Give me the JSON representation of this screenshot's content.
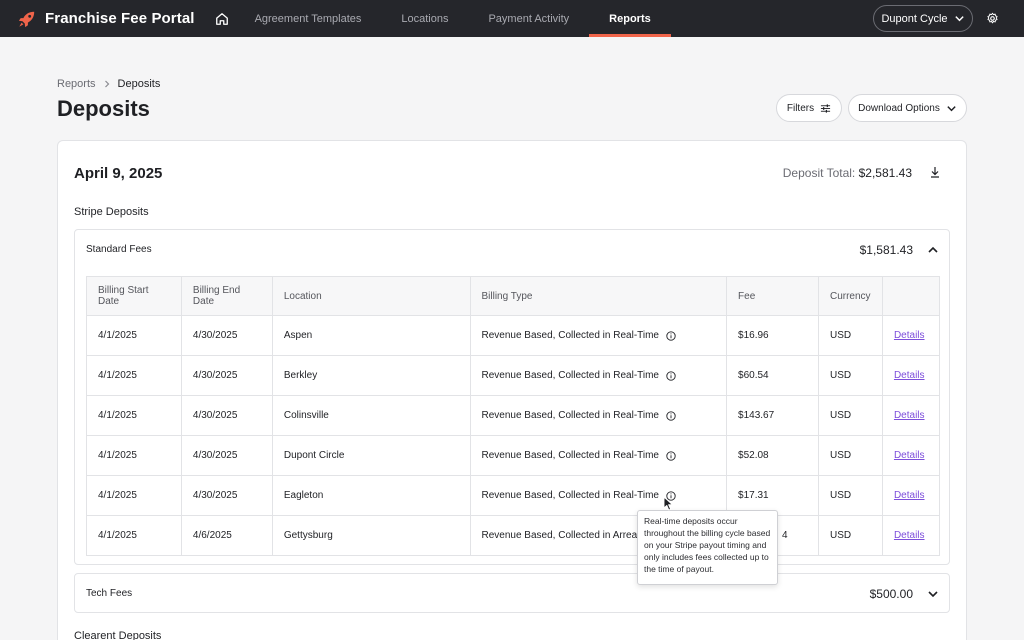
{
  "app": {
    "title": "Franchise Fee Portal"
  },
  "nav": {
    "items": [
      {
        "label": "Agreement Templates",
        "active": false
      },
      {
        "label": "Locations",
        "active": false
      },
      {
        "label": "Payment Activity",
        "active": false
      },
      {
        "label": "Reports",
        "active": true
      }
    ]
  },
  "account": {
    "name": "Dupont Cycle"
  },
  "breadcrumb": {
    "root": "Reports",
    "current": "Deposits"
  },
  "page": {
    "title": "Deposits"
  },
  "actions": {
    "filters_label": "Filters",
    "download_label": "Download Options"
  },
  "deposit": {
    "date": "April 9, 2025",
    "total_label": "Deposit Total:",
    "total_value": "$2,581.43",
    "stripe_title": "Stripe Deposits",
    "clearent_title": "Clearent Deposits"
  },
  "standard_fees": {
    "label": "Standard Fees",
    "amount": "$1,581.43",
    "columns": [
      "Billing Start Date",
      "Billing End Date",
      "Location",
      "Billing Type",
      "Fee",
      "Currency",
      ""
    ],
    "rows": [
      {
        "start": "4/1/2025",
        "end": "4/30/2025",
        "location": "Aspen",
        "type": "Revenue Based, Collected in Real-Time",
        "fee": "$16.96",
        "currency": "USD",
        "link": "Details"
      },
      {
        "start": "4/1/2025",
        "end": "4/30/2025",
        "location": "Berkley",
        "type": "Revenue Based, Collected in Real-Time",
        "fee": "$60.54",
        "currency": "USD",
        "link": "Details"
      },
      {
        "start": "4/1/2025",
        "end": "4/30/2025",
        "location": "Colinsville",
        "type": "Revenue Based, Collected in Real-Time",
        "fee": "$143.67",
        "currency": "USD",
        "link": "Details"
      },
      {
        "start": "4/1/2025",
        "end": "4/30/2025",
        "location": "Dupont Circle",
        "type": "Revenue Based, Collected in Real-Time",
        "fee": "$52.08",
        "currency": "USD",
        "link": "Details"
      },
      {
        "start": "4/1/2025",
        "end": "4/30/2025",
        "location": "Eagleton",
        "type": "Revenue Based, Collected in Real-Time",
        "fee": "$17.31",
        "currency": "USD",
        "link": "Details"
      },
      {
        "start": "4/1/2025",
        "end": "4/6/2025",
        "location": "Gettysburg",
        "type": "Revenue Based, Collected in Arrears",
        "fee": "4",
        "currency": "USD",
        "link": "Details"
      }
    ]
  },
  "tech_fees": {
    "label": "Tech Fees",
    "amount": "$500.00"
  },
  "tooltip": {
    "text": "Real-time deposits occur throughout the billing cycle based on your Stripe payout timing and only includes fees collected up to the time of payout."
  },
  "colors": {
    "accent": "#f0644a",
    "link": "#7c4ddb",
    "topbar": "#25262b"
  },
  "icons": [
    "rocket-logo-icon",
    "home-icon",
    "chevron-down-icon",
    "gear-icon",
    "sliders-icon",
    "download-icon",
    "chevron-up-icon",
    "info-icon",
    "cursor-icon"
  ]
}
